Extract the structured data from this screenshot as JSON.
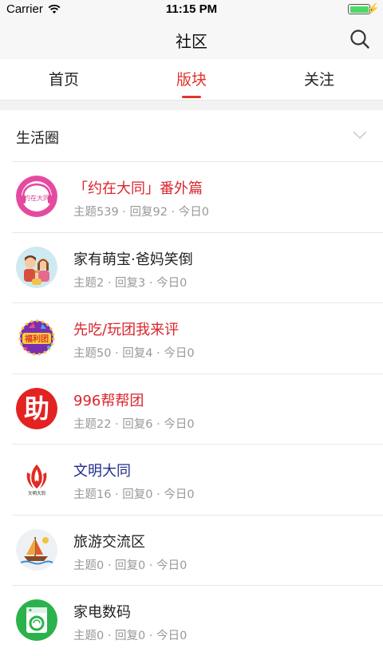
{
  "status_bar": {
    "carrier": "Carrier",
    "time": "11:15 PM",
    "battery_level": 1.0
  },
  "nav": {
    "title": "社区"
  },
  "tabs": [
    {
      "label": "首页",
      "active": false
    },
    {
      "label": "版块",
      "active": true
    },
    {
      "label": "关注",
      "active": false
    }
  ],
  "section": {
    "title": "生活圈"
  },
  "forums": [
    {
      "name": "「约在大同」番外篇",
      "meta": "主题539 · 回复92 · 今日0",
      "name_color": "red",
      "icon": "yuezai-datong-logo-icon",
      "icon_text": "约在大同"
    },
    {
      "name": "家有萌宝·爸妈笑倒",
      "meta": "主题2 · 回复3 · 今日0",
      "name_color": "default",
      "icon": "family-cartoon-icon"
    },
    {
      "name": "先吃/玩团我来评",
      "meta": "主题50 · 回复4 · 今日0",
      "name_color": "red",
      "icon": "fuli-tuan-badge-icon",
      "icon_text": "福利团"
    },
    {
      "name": "996帮帮团",
      "meta": "主题22 · 回复6 · 今日0",
      "name_color": "red",
      "icon": "help-character-icon",
      "icon_text": "助"
    },
    {
      "name": "文明大同",
      "meta": "主题16 · 回复0 · 今日0",
      "name_color": "navy",
      "icon": "wenming-datong-logo-icon",
      "icon_text": "文明大同"
    },
    {
      "name": "旅游交流区",
      "meta": "主题0 · 回复0 · 今日0",
      "name_color": "default",
      "icon": "sailboat-icon"
    },
    {
      "name": "家电数码",
      "meta": "主题0 · 回复0 · 今日0",
      "name_color": "default",
      "icon": "washing-machine-icon"
    }
  ],
  "colors": {
    "accent": "#e0352b",
    "navy": "#1f2c8f",
    "meta": "#999999"
  }
}
